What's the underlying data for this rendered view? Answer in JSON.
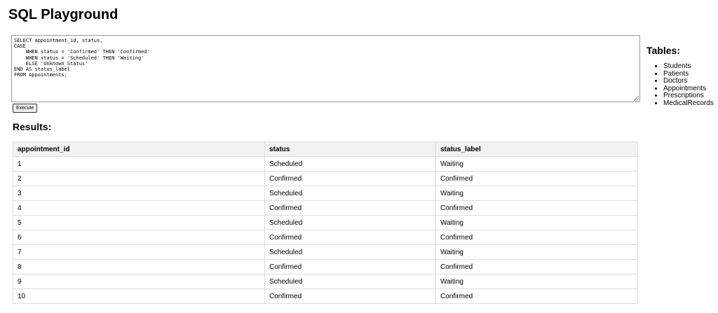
{
  "page": {
    "title": "SQL Playground"
  },
  "editor": {
    "query": "SELECT appointment_id, status,\nCASE\n    WHEN status = 'Confirmed' THEN 'Confirmed'\n    WHEN status = 'Scheduled' THEN 'Waiting'\n    ELSE 'Unknown Status'\nEND AS status_label\nFROM Appointments;",
    "execute_label": "Execute"
  },
  "results": {
    "heading": "Results:",
    "columns": [
      "appointment_id",
      "status",
      "status_label"
    ],
    "rows": [
      [
        "1",
        "Scheduled",
        "Waiting"
      ],
      [
        "2",
        "Confirmed",
        "Confirmed"
      ],
      [
        "3",
        "Scheduled",
        "Waiting"
      ],
      [
        "4",
        "Confirmed",
        "Confirmed"
      ],
      [
        "5",
        "Scheduled",
        "Waiting"
      ],
      [
        "6",
        "Confirmed",
        "Confirmed"
      ],
      [
        "7",
        "Scheduled",
        "Waiting"
      ],
      [
        "8",
        "Confirmed",
        "Confirmed"
      ],
      [
        "9",
        "Scheduled",
        "Waiting"
      ],
      [
        "10",
        "Confirmed",
        "Confirmed"
      ]
    ]
  },
  "tables_panel": {
    "heading": "Tables:",
    "items": [
      "Students",
      "Patients",
      "Doctors",
      "Appointments",
      "Prescriptions",
      "MedicalRecords"
    ]
  },
  "colors": {
    "header_background": "#f2f2f2",
    "table_border": "#dddddd"
  }
}
